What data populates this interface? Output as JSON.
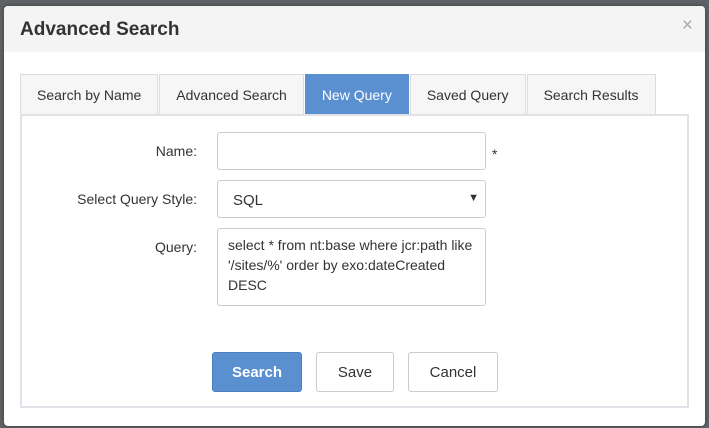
{
  "dialog": {
    "title": "Advanced Search",
    "close_glyph": "×"
  },
  "tabs": [
    {
      "label": "Search by Name",
      "active": false
    },
    {
      "label": "Advanced Search",
      "active": false
    },
    {
      "label": "New Query",
      "active": true
    },
    {
      "label": "Saved Query",
      "active": false
    },
    {
      "label": "Search Results",
      "active": false
    }
  ],
  "form": {
    "name_label": "Name:",
    "name_value": "",
    "required_mark": "*",
    "style_label": "Select Query Style:",
    "style_value": "SQL",
    "query_label": "Query:",
    "query_value": "select * from nt:base where jcr:path like '/sites/%' order by exo:dateCreated DESC"
  },
  "buttons": {
    "search": "Search",
    "save": "Save",
    "cancel": "Cancel"
  },
  "colors": {
    "accent": "#5a8fd0",
    "header_bg": "#f4f4f4",
    "backdrop": "#5f6266"
  },
  "icons": {
    "close": "close-icon",
    "dropdown": "chevron-down-icon"
  }
}
